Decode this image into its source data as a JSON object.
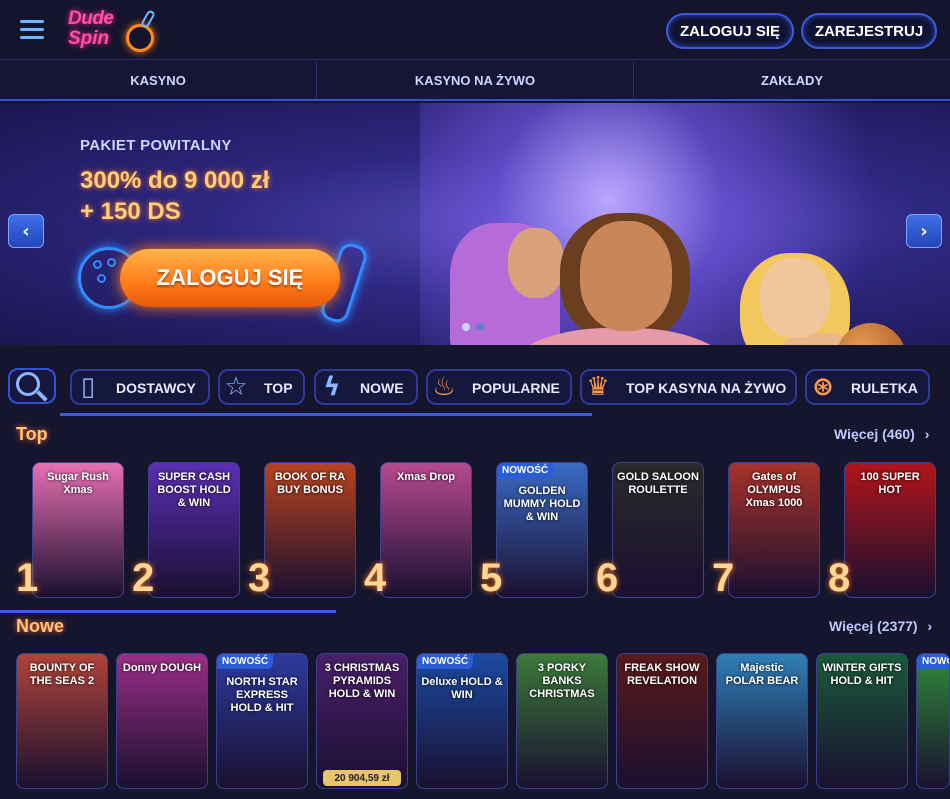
{
  "header": {
    "logo_line1": "Dude",
    "logo_line2": "Spin",
    "login_label": "ZALOGUJ SIĘ",
    "register_label": "ZAREJESTRUJ"
  },
  "nav": {
    "items": [
      "KASYNO",
      "KASYNO NA ŻYWO",
      "ZAKŁADY"
    ]
  },
  "banner": {
    "label": "PAKIET POWITALNY",
    "amount_line1": "300% do 9 000 zł",
    "amount_line2": "+ 150 DS",
    "cta_label": "ZALOGUJ SIĘ",
    "prev_arrow": "‹",
    "next_arrow": "›"
  },
  "categories": [
    {
      "label": "DOSTAWCY",
      "icon": "book-icon",
      "glyph": "▯",
      "color": "#8eb5ff"
    },
    {
      "label": "TOP",
      "icon": "star-icon",
      "glyph": "☆",
      "color": "#8eb5ff"
    },
    {
      "label": "NOWE",
      "icon": "lightning-icon",
      "glyph": "ϟ",
      "color": "#8eb5ff"
    },
    {
      "label": "POPULARNE",
      "icon": "flame-icon",
      "glyph": "♨",
      "color": "#ff9a4a"
    },
    {
      "label": "TOP KASYNA NA ŻYWO",
      "icon": "crown-icon",
      "glyph": "♛",
      "color": "#ff9a4a"
    },
    {
      "label": "RULETKA",
      "icon": "roulette-icon",
      "glyph": "⊛",
      "color": "#ff9a4a"
    }
  ],
  "sections": {
    "top": {
      "title": "Top",
      "more": "Więcej (460)",
      "games": [
        {
          "rank": "1",
          "title": "Sugar Rush Xmas",
          "bg": "#e86fb4"
        },
        {
          "rank": "2",
          "title": "SUPER CASH BOOST HOLD & WIN",
          "bg": "#5b2fb3"
        },
        {
          "rank": "3",
          "title": "BOOK OF RA BUY BONUS",
          "bg": "#b8431f"
        },
        {
          "rank": "4",
          "title": "Xmas Drop",
          "bg": "#b84a8f"
        },
        {
          "rank": "5",
          "title": "GOLDEN MUMMY HOLD & WIN",
          "bg": "#3a6bc4",
          "new": "NOWOŚĆ"
        },
        {
          "rank": "6",
          "title": "GOLD SALOON ROULETTE",
          "bg": "#2a2a2a"
        },
        {
          "rank": "7",
          "title": "Gates of OLYMPUS Xmas 1000",
          "bg": "#a8322a"
        },
        {
          "rank": "8",
          "title": "100 SUPER HOT",
          "bg": "#b1141a"
        }
      ]
    },
    "nowe": {
      "title": "Nowe",
      "more": "Więcej (2377)",
      "games": [
        {
          "title": "BOUNTY OF THE SEAS 2",
          "bg": "#b0443a"
        },
        {
          "title": "Donny DOUGH",
          "bg": "#9a2e86"
        },
        {
          "title": "NORTH STAR EXPRESS HOLD & HIT",
          "bg": "#2d3a9e",
          "new": "NOWOŚĆ"
        },
        {
          "title": "3 CHRISTMAS PYRAMIDS HOLD & WIN",
          "bg": "#4a1f6a",
          "jackpot": "20 904,59 zł"
        },
        {
          "title": "Deluxe HOLD & WIN",
          "bg": "#1a4aa0",
          "new": "NOWOŚĆ"
        },
        {
          "title": "3 PORKY BANKS CHRISTMAS",
          "bg": "#3c7a3a"
        },
        {
          "title": "FREAK SHOW REVELATION",
          "bg": "#5a1a1a"
        },
        {
          "title": "Majestic POLAR BEAR",
          "bg": "#2f7fb8"
        },
        {
          "title": "WINTER GIFTS HOLD & HIT",
          "bg": "#1a5a3a"
        },
        {
          "title": "",
          "bg": "#2f8a3a",
          "new": "NOWO"
        }
      ]
    }
  }
}
